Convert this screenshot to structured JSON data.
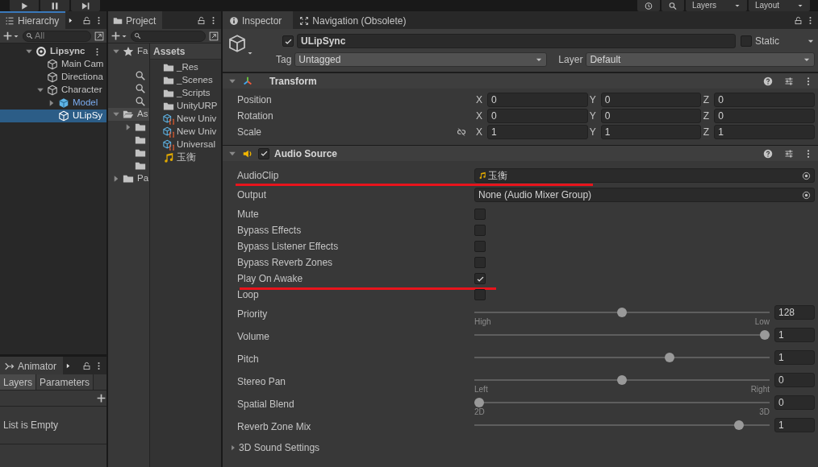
{
  "toolbar": {
    "dropdowns": [
      "Layers",
      "Layout"
    ]
  },
  "hierarchy": {
    "title": "Hierarchy",
    "focused": true,
    "search_placeholder": "All",
    "tree": [
      {
        "label": "Lipsync",
        "kind": "scene",
        "expanded": true,
        "selected": false,
        "children": [
          {
            "label": "Main Cam",
            "kind": "object",
            "selected": false
          },
          {
            "label": "Directiona",
            "kind": "object",
            "selected": false
          },
          {
            "label": "Character",
            "kind": "object",
            "expanded": true,
            "selected": false,
            "children": [
              {
                "label": "Model",
                "kind": "prefab",
                "expanded": false,
                "selected": false
              },
              {
                "label": "ULipSy",
                "kind": "object",
                "selected": true
              }
            ]
          }
        ]
      }
    ]
  },
  "animator": {
    "title": "Animator",
    "tabs": [
      {
        "label": "Layers",
        "selected": true
      },
      {
        "label": "Parameters",
        "selected": false
      }
    ],
    "empty_text": "List is Empty"
  },
  "project": {
    "title": "Project",
    "tree": [
      {
        "label": "Fa",
        "kind": "favorites",
        "expanded": true,
        "selected": false,
        "children": [
          {
            "kind": "search",
            "selected": false
          },
          {
            "kind": "search",
            "selected": false
          },
          {
            "kind": "search",
            "selected": false
          }
        ]
      },
      {
        "label": "As",
        "kind": "folder",
        "expanded": true,
        "selected": true,
        "children": [
          {
            "kind": "folder",
            "expanded": false,
            "selected": false
          },
          {
            "kind": "folder",
            "selected": false
          },
          {
            "kind": "folder",
            "selected": false
          },
          {
            "kind": "folder",
            "selected": false
          }
        ]
      },
      {
        "label": "Pa",
        "kind": "folder",
        "expanded": false,
        "selected": false
      }
    ],
    "breadcrumb": "Assets",
    "assets": [
      {
        "name": "_Res",
        "kind": "folder"
      },
      {
        "name": "_Scenes",
        "kind": "folder"
      },
      {
        "name": "_Scripts",
        "kind": "folder"
      },
      {
        "name": "UnityURP",
        "kind": "folder"
      },
      {
        "name": "New Univ",
        "kind": "asset"
      },
      {
        "name": "New Univ",
        "kind": "asset"
      },
      {
        "name": "Universal",
        "kind": "asset"
      },
      {
        "name": "玉衡",
        "kind": "audio"
      }
    ]
  },
  "inspector": {
    "tabs": [
      {
        "label": "Inspector",
        "kind": "info",
        "selected": true
      },
      {
        "label": "Navigation (Obsolete)",
        "kind": "navigation",
        "selected": false
      }
    ],
    "object": {
      "active": true,
      "name": "ULipSync",
      "static": false,
      "static_label": "Static",
      "tag_label": "Tag",
      "tag": "Untagged",
      "layer_label": "Layer",
      "layer": "Default"
    },
    "components": [
      {
        "title": "Transform",
        "kind": "transform",
        "expanded": true,
        "rows": [
          {
            "label": "Position",
            "kind": "vector",
            "fields": [
              {
                "axis": "X",
                "value": "0"
              },
              {
                "axis": "Y",
                "value": "0"
              },
              {
                "axis": "Z",
                "value": "0"
              }
            ]
          },
          {
            "label": "Rotation",
            "kind": "vector",
            "fields": [
              {
                "axis": "X",
                "value": "0"
              },
              {
                "axis": "Y",
                "value": "0"
              },
              {
                "axis": "Z",
                "value": "0"
              }
            ]
          },
          {
            "label": "Scale",
            "kind": "vector",
            "constrain_proportions": false,
            "fields": [
              {
                "axis": "X",
                "value": "1"
              },
              {
                "axis": "Y",
                "value": "1"
              },
              {
                "axis": "Z",
                "value": "1"
              }
            ]
          }
        ]
      },
      {
        "title": "Audio Source",
        "kind": "audio",
        "expanded": true,
        "enabled": true,
        "rows": [
          {
            "label": "AudioClip",
            "kind": "object",
            "value": "玉衡",
            "value_icon": true,
            "underlined": true
          },
          {
            "label": "Output",
            "kind": "object",
            "value": "None (Audio Mixer Group)",
            "underlined": false
          },
          {
            "label": "Mute",
            "kind": "toggle",
            "checked": false,
            "underlined": false
          },
          {
            "label": "Bypass Effects",
            "kind": "toggle",
            "checked": false,
            "underlined": false
          },
          {
            "label": "Bypass Listener Effects",
            "kind": "toggle",
            "checked": false,
            "underlined": false
          },
          {
            "label": "Bypass Reverb Zones",
            "kind": "toggle",
            "checked": false,
            "underlined": false
          },
          {
            "label": "Play On Awake",
            "kind": "toggle",
            "checked": true,
            "underlined": true
          },
          {
            "label": "Loop",
            "kind": "toggle",
            "checked": false,
            "underlined": false
          },
          {
            "label": "Priority",
            "kind": "slider",
            "level": 0.5,
            "value": "128",
            "min_label": "High",
            "max_label": "Low"
          },
          {
            "label": "Volume",
            "kind": "slider",
            "level": 1,
            "value": "1"
          },
          {
            "label": "Pitch",
            "kind": "slider",
            "level": 0.667,
            "value": "1"
          },
          {
            "label": "Stereo Pan",
            "kind": "slider",
            "level": 0.5,
            "value": "0",
            "min_label": "Left",
            "max_label": "Right"
          },
          {
            "label": "Spatial Blend",
            "kind": "slider",
            "level": 0,
            "value": "0",
            "min_label": "2D",
            "max_label": "3D"
          },
          {
            "label": "Reverb Zone Mix",
            "kind": "slider",
            "level": 0.909,
            "value": "1"
          }
        ],
        "foldouts": [
          {
            "label": "3D Sound Settings",
            "expanded": false
          }
        ]
      }
    ]
  }
}
